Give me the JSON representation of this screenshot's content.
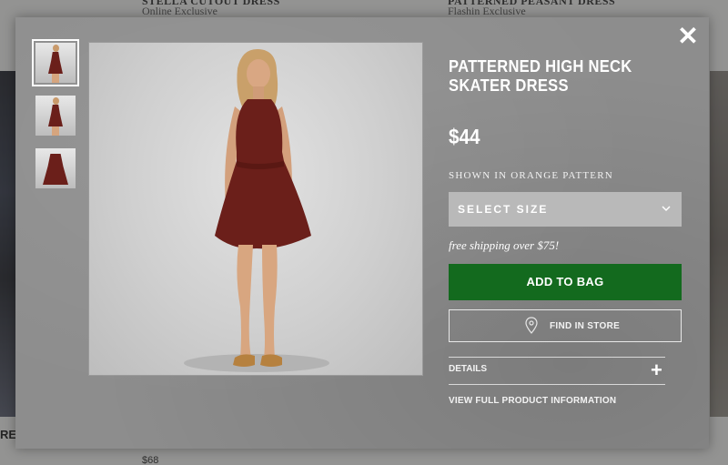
{
  "background": {
    "top_items": [
      {
        "title": "STELLA CUTOUT DRESS",
        "subtitle": "Online Exclusive"
      },
      {
        "title": "PATTERNED PEASANT DRESS",
        "subtitle": "Flashin Exclusive"
      }
    ],
    "left_label": "RE",
    "bottom_price": "$68"
  },
  "modal": {
    "close_label": "✕",
    "thumbnails": [
      {
        "icon": "model-front-thumbnail",
        "active": true
      },
      {
        "icon": "model-back-thumbnail",
        "active": false
      },
      {
        "icon": "dress-flat-thumbnail",
        "active": false
      }
    ],
    "product": {
      "title": "PATTERNED HIGH NECK SKATER DRESS",
      "price": "$44",
      "shown_in": "SHOWN IN ORANGE PATTERN",
      "size_select": "SELECT SIZE",
      "free_shipping": "free shipping over $75!",
      "add_to_bag": "ADD TO BAG",
      "find_in_store": "FIND IN STORE",
      "details": "DETAILS",
      "view_full": "VIEW FULL PRODUCT INFORMATION"
    },
    "colors": {
      "add_to_bag_bg": "#136a1e",
      "modal_bg": "#8d8d8d",
      "dress": "#6b1f1a"
    }
  }
}
